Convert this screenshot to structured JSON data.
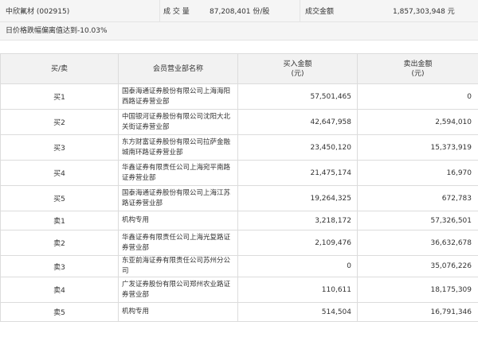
{
  "summary": {
    "stock": "中欣氟材 (002915)",
    "volume_label": "成 交 量",
    "volume_value": "87,208,401 份/股",
    "amount_label": "成交金额",
    "amount_value": "1,857,303,948 元"
  },
  "reason": "日价格跌幅偏离值达到-10.03%",
  "table": {
    "headers": {
      "direction": "买/卖",
      "dept": "会员营业部名称",
      "buy": "买入金额\n(元)",
      "sell": "卖出金额\n(元)"
    },
    "rows": [
      {
        "dir": "买1",
        "dept": "国泰海通证券股份有限公司上海海阳西路证券营业部",
        "buy": "57,501,465",
        "sell": "0"
      },
      {
        "dir": "买2",
        "dept": "中国银河证券股份有限公司沈阳大北关街证券营业部",
        "buy": "42,647,958",
        "sell": "2,594,010"
      },
      {
        "dir": "买3",
        "dept": "东方财富证券股份有限公司拉萨金融城南环路证券营业部",
        "buy": "23,450,120",
        "sell": "15,373,919"
      },
      {
        "dir": "买4",
        "dept": "华鑫证券有限责任公司上海宛平南路证券营业部",
        "buy": "21,475,174",
        "sell": "16,970"
      },
      {
        "dir": "买5",
        "dept": "国泰海通证券股份有限公司上海江苏路证券营业部",
        "buy": "19,264,325",
        "sell": "672,783"
      },
      {
        "dir": "卖1",
        "dept": "机构专用",
        "buy": "3,218,172",
        "sell": "57,326,501"
      },
      {
        "dir": "卖2",
        "dept": "华鑫证券有限责任公司上海光复路证券营业部",
        "buy": "2,109,476",
        "sell": "36,632,678"
      },
      {
        "dir": "卖3",
        "dept": "东亚前海证券有限责任公司苏州分公司",
        "buy": "0",
        "sell": "35,076,226"
      },
      {
        "dir": "卖4",
        "dept": "广发证券股份有限公司郑州农业路证券营业部",
        "buy": "110,611",
        "sell": "18,175,309"
      },
      {
        "dir": "卖5",
        "dept": "机构专用",
        "buy": "514,504",
        "sell": "16,791,346"
      }
    ]
  }
}
